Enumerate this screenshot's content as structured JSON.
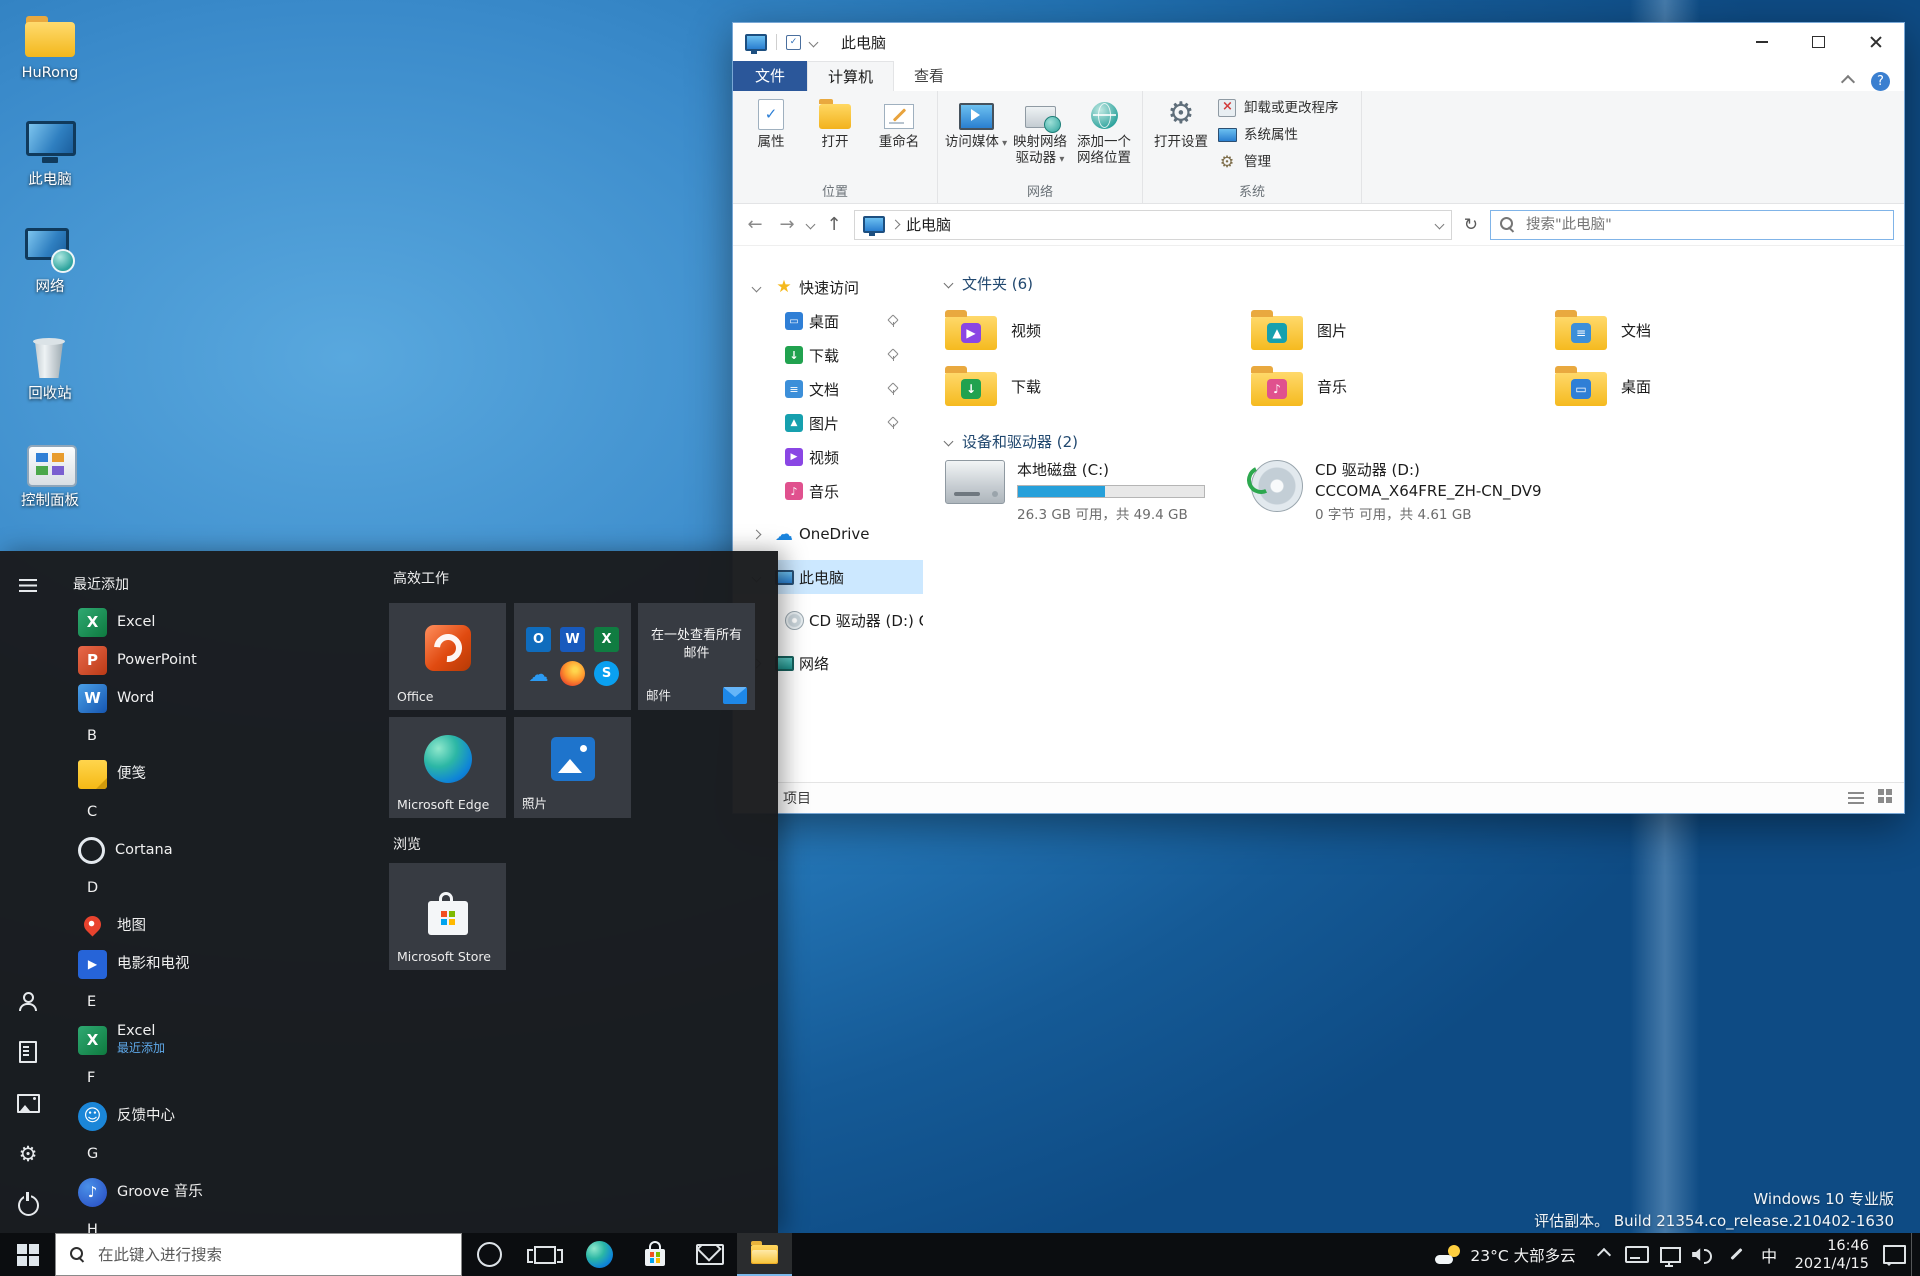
{
  "colors": {
    "accent": "#0078d7",
    "drive_bar_fill": "#26a0da",
    "file_tab": "#2b579a",
    "selection": "#cce8ff"
  },
  "desktop": {
    "icons": [
      {
        "label": "HuRong",
        "icon": "dt-user"
      },
      {
        "label": "此电脑",
        "icon": "dt-pc"
      },
      {
        "label": "网络",
        "icon": "dt-net"
      },
      {
        "label": "回收站",
        "icon": "dt-recycle"
      },
      {
        "label": "控制面板",
        "icon": "dt-cpl"
      }
    ],
    "watermark_line1": "Windows 10 专业版",
    "watermark_line2": "评估副本。 Build 21354.co_release.210402-1630"
  },
  "explorer": {
    "title": "此电脑",
    "help_label": "?",
    "tabs": {
      "file": "文件",
      "computer": "计算机",
      "view": "查看"
    },
    "ribbon": {
      "groups": [
        {
          "label": "位置",
          "buttons": [
            {
              "label": "属性",
              "icon": "rb-props",
              "cls": "large"
            },
            {
              "label": "打开",
              "icon": "rb-open",
              "cls": "large"
            },
            {
              "label": "重命名",
              "icon": "rb-rename",
              "cls": "large"
            }
          ]
        },
        {
          "label": "网络",
          "buttons": [
            {
              "label": "访问媒体",
              "icon": "rb-media",
              "cls": "large dd"
            },
            {
              "label": "映射网络驱动器",
              "icon": "rb-map",
              "cls": "large dd"
            },
            {
              "label": "添加一个网络位置",
              "icon": "rb-addnet",
              "cls": "large"
            }
          ]
        },
        {
          "label": "系统",
          "buttons": [
            {
              "label": "打开设置",
              "icon": "rb-settings",
              "cls": "large"
            },
            {
              "label": "卸载或更改程序",
              "icon": "rb-uninstall",
              "cls": "small"
            },
            {
              "label": "系统属性",
              "icon": "rb-sysprops",
              "cls": "small"
            },
            {
              "label": "管理",
              "icon": "rb-manage",
              "cls": "small"
            }
          ]
        }
      ]
    },
    "address": {
      "location": "此电脑",
      "search_placeholder": "搜索\"此电脑\""
    },
    "sidebar": {
      "quick_access": "快速访问",
      "items": [
        {
          "label": "桌面",
          "icon": "si-desktop",
          "cls": "pinned"
        },
        {
          "label": "下载",
          "icon": "si-down",
          "cls": "pinned"
        },
        {
          "label": "文档",
          "icon": "si-doc",
          "cls": "pinned"
        },
        {
          "label": "图片",
          "icon": "si-pic",
          "cls": "pinned"
        },
        {
          "label": "视频",
          "icon": "si-vid"
        },
        {
          "label": "音乐",
          "icon": "si-mus"
        }
      ],
      "onedrive": "OneDrive",
      "this_pc": "此电脑",
      "cd_drive": "CD 驱动器 (D:) CCC",
      "network": "网络"
    },
    "content": {
      "folders_header": "文件夹 (6)",
      "folders": [
        {
          "label": "视频",
          "icon": "fd-vid"
        },
        {
          "label": "图片",
          "icon": "fd-pic"
        },
        {
          "label": "文档",
          "icon": "fd-doc"
        },
        {
          "label": "下载",
          "icon": "fd-down"
        },
        {
          "label": "音乐",
          "icon": "fd-mus"
        },
        {
          "label": "桌面",
          "icon": "fd-desk"
        }
      ],
      "devices_header": "设备和驱动器 (2)",
      "disk_c": {
        "name": "本地磁盘 (C:)",
        "detail": "26.3 GB 可用，共 49.4 GB",
        "used_percent": 47
      },
      "disk_d": {
        "name": "CD 驱动器 (D:)",
        "volume": "CCCOMA_X64FRE_ZH-CN_DV9",
        "detail": "0 字节 可用，共 4.61 GB"
      }
    },
    "statusbar": {
      "items_label": "项目"
    }
  },
  "start": {
    "recent_header": "最近添加",
    "list": [
      {
        "label": "Excel",
        "icon": "ap-excel",
        "cls": "app"
      },
      {
        "label": "PowerPoint",
        "icon": "ap-ppt",
        "cls": "app"
      },
      {
        "label": "Word",
        "icon": "ap-word",
        "cls": "app"
      },
      {
        "label": "B",
        "cls": "letter"
      },
      {
        "label": "便笺",
        "icon": "ap-sticky",
        "cls": "app"
      },
      {
        "label": "C",
        "cls": "letter"
      },
      {
        "label": "Cortana",
        "icon": "ap-cortana",
        "cls": "app"
      },
      {
        "label": "D",
        "cls": "letter"
      },
      {
        "label": "地图",
        "icon": "ap-maps",
        "cls": "app"
      },
      {
        "label": "电影和电视",
        "icon": "ap-movies",
        "cls": "app"
      },
      {
        "label": "E",
        "cls": "letter"
      },
      {
        "label": "Excel",
        "sub": "最近添加",
        "icon": "ap-excel",
        "cls": "app"
      },
      {
        "label": "F",
        "cls": "letter"
      },
      {
        "label": "反馈中心",
        "icon": "ap-feedback",
        "cls": "app"
      },
      {
        "label": "G",
        "cls": "letter"
      },
      {
        "label": "Groove 音乐",
        "icon": "ap-groove",
        "cls": "app"
      },
      {
        "label": "H",
        "cls": "letter"
      }
    ],
    "tiles": {
      "group1": "高效工作",
      "office": "Office",
      "mail_center": "在一处查看所有邮件",
      "mail_label": "邮件",
      "edge": "Microsoft Edge",
      "photos": "照片",
      "group2": "浏览",
      "store": "Microsoft Store"
    }
  },
  "taskbar": {
    "search_placeholder": "在此键入进行搜索",
    "weather": "23°C 大部多云",
    "ime": "中",
    "time": "16:46",
    "date": "2021/4/15"
  }
}
